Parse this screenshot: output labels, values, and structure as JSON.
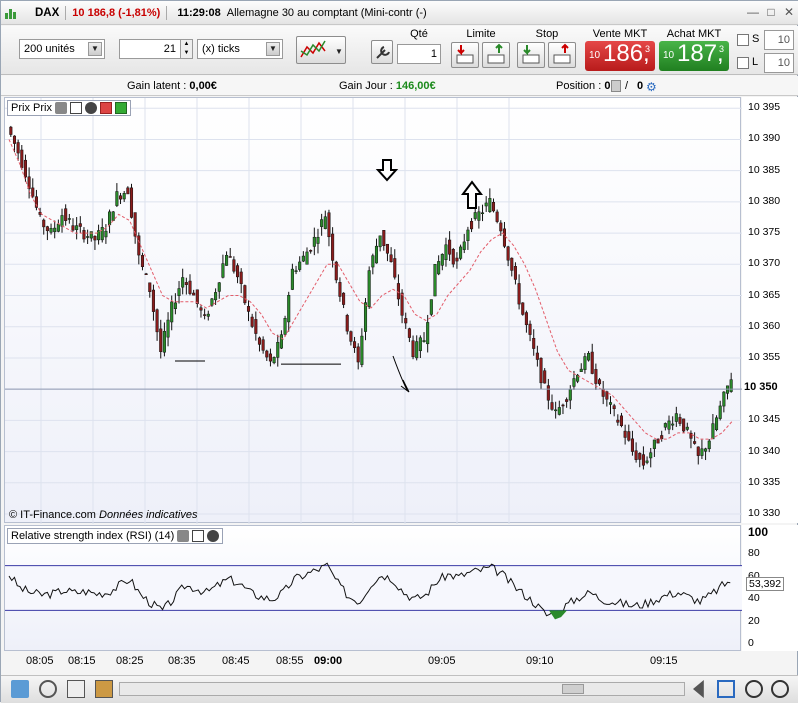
{
  "titlebar": {
    "title": "DAX",
    "price_change": "10 186,8 (-1,81%)",
    "time": "11:29:08",
    "instrument": "Allemagne 30 au comptant (Mini-contr (-)"
  },
  "order": {
    "size_value": "200 unités",
    "ticks_value": "21",
    "ticks_unit": "(x) ticks",
    "qty_label": "Qté",
    "qty_value": "1",
    "limit_label": "Limite",
    "stop_label": "Stop",
    "sell_label": "Vente MKT",
    "sell_small": "10",
    "sell_big": "186,",
    "sell_sup": "3",
    "buy_label": "Achat MKT",
    "buy_small": "10",
    "buy_big": "187,",
    "buy_sup": "3",
    "s_label": "S",
    "s_value": "10",
    "l_label": "L",
    "l_value": "10",
    "colors": {
      "sell": "#d42b2b",
      "buy": "#2e9a2e"
    }
  },
  "info": {
    "latent_label": "Gain latent :",
    "latent_value": "0,00€",
    "day_label": "Gain Jour :",
    "day_value": "146,00€",
    "position_label": "Position :",
    "position_value": "0",
    "position_sep": "/",
    "position_value2": "0"
  },
  "price_panel": {
    "title": "Prix Prix",
    "copyright": "© IT-Finance.com",
    "disclaimer": "Données indicatives",
    "last_price": "10 350",
    "y_ticks": [
      "10 395",
      "10 390",
      "10 385",
      "10 380",
      "10 375",
      "10 370",
      "10 365",
      "10 360",
      "10 355",
      "10 345",
      "10 340",
      "10 335",
      "10 330"
    ]
  },
  "rsi_panel": {
    "title": "Relative strength index (RSI) (14)",
    "last_value": "53,392",
    "y_ticks": [
      "100",
      "80",
      "60",
      "40",
      "20",
      "0"
    ]
  },
  "x_ticks": [
    "08:05",
    "08:15",
    "08:25",
    "08:35",
    "08:45",
    "08:55",
    "09:00",
    "09:05",
    "09:10",
    "09:15"
  ],
  "chart_data": [
    {
      "type": "candlestick",
      "title": "Prix Prix",
      "ylim": [
        10330,
        10396
      ],
      "x_labels": [
        "08:05",
        "08:15",
        "08:25",
        "08:35",
        "08:45",
        "08:55",
        "09:00",
        "09:05",
        "09:10",
        "09:15"
      ],
      "close_path": [
        10392,
        10388,
        10383,
        10377,
        10375,
        10378,
        10376,
        10375,
        10374,
        10376,
        10381,
        10382,
        10371,
        10366,
        10356,
        10363,
        10368,
        10365,
        10361,
        10366,
        10372,
        10368,
        10362,
        10357,
        10354,
        10358,
        10369,
        10371,
        10374,
        10378,
        10368,
        10360,
        10354,
        10369,
        10375,
        10370,
        10362,
        10356,
        10358,
        10369,
        10373,
        10370,
        10376,
        10378,
        10380,
        10376,
        10369,
        10362,
        10356,
        10350,
        10346,
        10349,
        10353,
        10355,
        10350,
        10347,
        10344,
        10340,
        10338,
        10341,
        10344,
        10346,
        10343,
        10339,
        10342,
        10347,
        10352
      ],
      "moving_average": [
        10390,
        10386,
        10381,
        10378,
        10377,
        10376,
        10375,
        10375,
        10375,
        10376,
        10378,
        10377,
        10373,
        10369,
        10365,
        10364,
        10364,
        10364,
        10363,
        10364,
        10365,
        10365,
        10364,
        10362,
        10359,
        10358,
        10361,
        10364,
        10367,
        10370,
        10370,
        10367,
        10364,
        10363,
        10365,
        10366,
        10365,
        10362,
        10361,
        10362,
        10365,
        10367,
        10369,
        10372,
        10374,
        10375,
        10373,
        10370,
        10366,
        10361,
        10356,
        10353,
        10352,
        10351,
        10350,
        10349,
        10347,
        10345,
        10343,
        10342,
        10342,
        10343,
        10343,
        10342,
        10342,
        10343,
        10345
      ],
      "last_price": 10350
    },
    {
      "type": "line",
      "title": "Relative strength index (RSI) (14)",
      "ylim": [
        0,
        100
      ],
      "levels": [
        70,
        30
      ],
      "values": [
        62,
        50,
        46,
        44,
        45,
        48,
        46,
        47,
        45,
        46,
        52,
        58,
        44,
        36,
        30,
        40,
        52,
        50,
        46,
        52,
        58,
        54,
        46,
        42,
        40,
        46,
        58,
        62,
        66,
        70,
        54,
        42,
        38,
        54,
        62,
        58,
        46,
        40,
        44,
        56,
        62,
        60,
        64,
        66,
        68,
        62,
        52,
        44,
        36,
        26,
        28,
        36,
        42,
        46,
        40,
        38,
        36,
        34,
        36,
        40,
        44,
        46,
        42,
        38,
        44,
        52,
        58
      ],
      "last_value": 53.392
    }
  ]
}
